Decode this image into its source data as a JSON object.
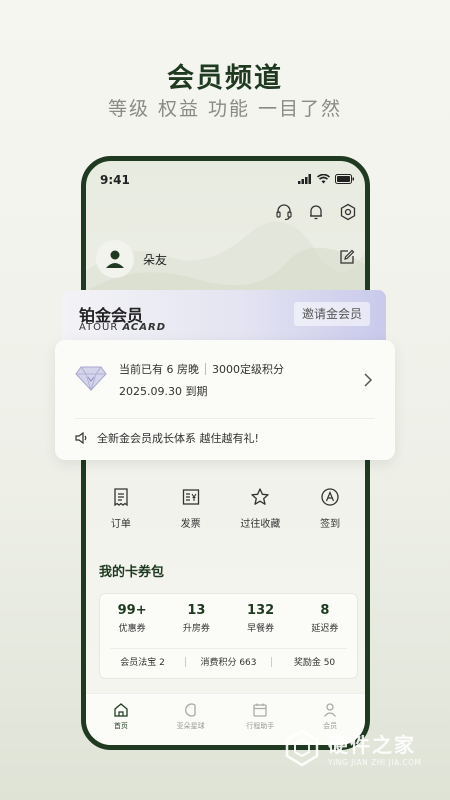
{
  "promo": {
    "headline": "会员频道",
    "subline": "等级 权益 功能 一目了然"
  },
  "status_bar": {
    "time": "9:41"
  },
  "profile": {
    "name": "朵友"
  },
  "membership_card": {
    "tier": "铂金会员",
    "brand_prefix": "ATOUR",
    "brand_suffix": "ACARD",
    "invite_label": "邀请金会员"
  },
  "info_card": {
    "stay_text": "当前已有 6 房晚",
    "points_text": "3000定级积分",
    "expire_text": "2025.09.30 到期",
    "notice": "全新金会员成长体系 越住越有礼!"
  },
  "quick_actions": [
    {
      "label": "订单",
      "icon": "order-icon"
    },
    {
      "label": "发票",
      "icon": "invoice-icon"
    },
    {
      "label": "过往收藏",
      "icon": "star-icon"
    },
    {
      "label": "签到",
      "icon": "checkin-icon"
    }
  ],
  "wallet": {
    "title": "我的卡券包",
    "coupons": [
      {
        "value": "99+",
        "label": "优惠券"
      },
      {
        "value": "13",
        "label": "升房券"
      },
      {
        "value": "132",
        "label": "早餐券"
      },
      {
        "value": "8",
        "label": "延迟券"
      }
    ],
    "stats": [
      {
        "text": "会员法宝 2"
      },
      {
        "text": "消费积分 663"
      },
      {
        "text": "奖励金 50"
      }
    ]
  },
  "tab_bar": [
    {
      "label": "首页",
      "icon": "home-icon",
      "active": true
    },
    {
      "label": "亚朵星球",
      "icon": "planet-icon",
      "active": false
    },
    {
      "label": "行程助手",
      "icon": "calendar-icon",
      "active": false
    },
    {
      "label": "会员",
      "icon": "member-icon",
      "active": false
    }
  ],
  "watermark": {
    "main": "硬件之家",
    "sub": "YING JIAN ZHI JIA.COM"
  },
  "colors": {
    "brand_green": "#1f3a20",
    "background": "#f6f6f1",
    "card_lavender": "#c9c9ec"
  }
}
